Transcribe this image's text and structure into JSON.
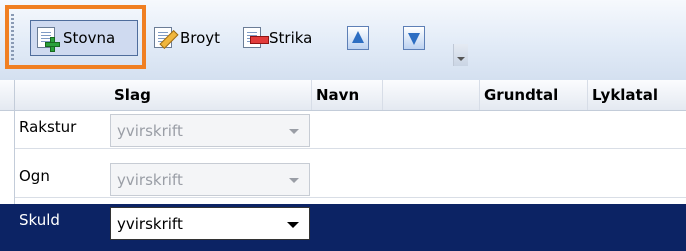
{
  "toolbar": {
    "buttons": [
      {
        "label": "Stovna",
        "icon": "add-document-icon"
      },
      {
        "label": "Broyt",
        "icon": "edit-document-icon"
      },
      {
        "label": "Strika",
        "icon": "delete-document-icon"
      },
      {
        "label": "",
        "icon": "move-up-arrow-icon"
      },
      {
        "label": "",
        "icon": "move-down-arrow-icon"
      }
    ]
  },
  "grid": {
    "columns": [
      "Slag",
      "Navn",
      "",
      "Grundtal",
      "Lyklatal"
    ],
    "rows": [
      {
        "name": "Rakstur",
        "slag": "yvirskrift",
        "selected": false
      },
      {
        "name": "Ogn",
        "slag": "yvirskrift",
        "selected": false
      },
      {
        "name": "Skuld",
        "slag": "yvirskrift",
        "selected": true
      }
    ]
  },
  "colors": {
    "highlight": "#f07f22",
    "selected_row": "#0c2364",
    "toolbar_bg": "#dde7f5"
  }
}
